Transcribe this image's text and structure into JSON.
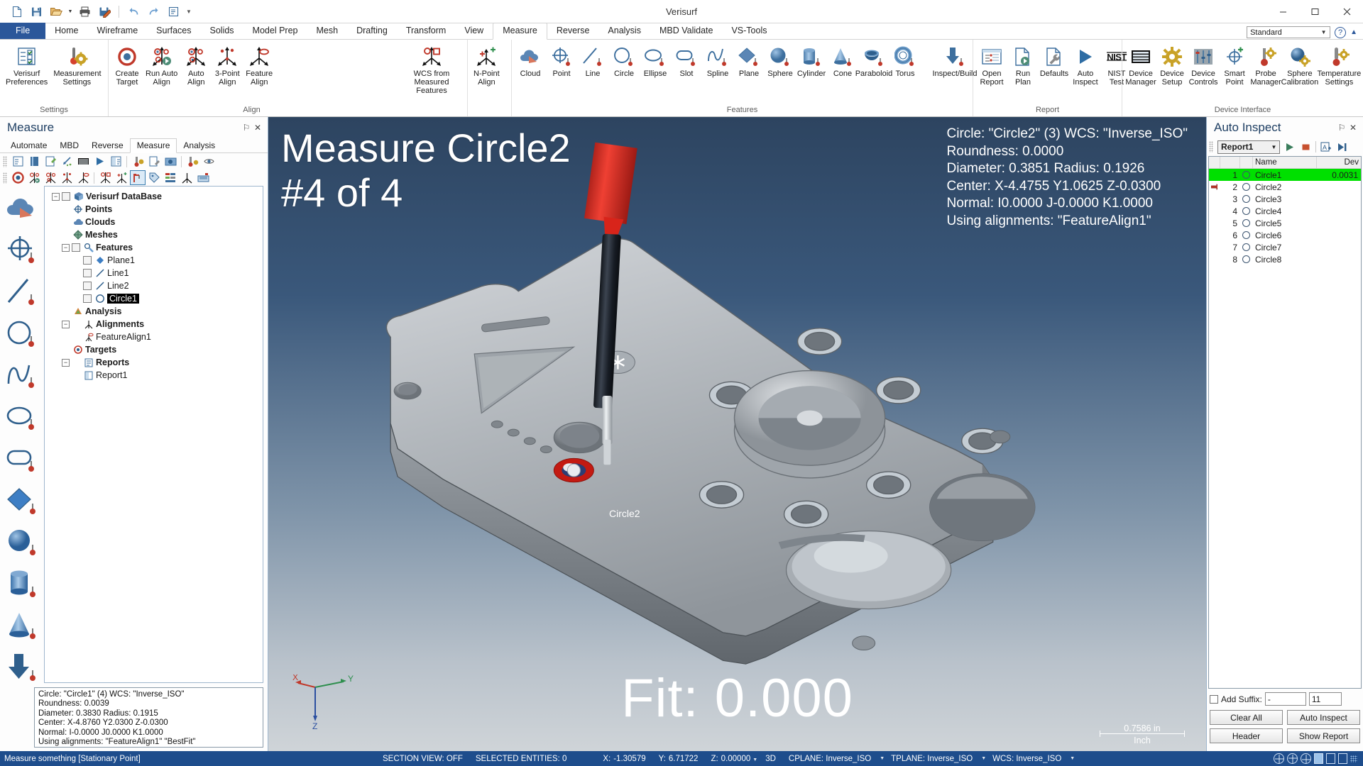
{
  "window": {
    "title": "Verisurf",
    "minimize": "–",
    "maximize": "☐",
    "close": "✕"
  },
  "quick_access": [
    {
      "name": "new-icon",
      "label": "New"
    },
    {
      "name": "save-icon",
      "label": "Save"
    },
    {
      "name": "open-icon",
      "label": "Open"
    },
    {
      "name": "open-dropdown-icon",
      "label": "▾"
    },
    {
      "name": "print-icon",
      "label": "Print"
    },
    {
      "name": "save-as-icon",
      "label": "Save As"
    },
    {
      "name": "undo-icon",
      "label": "Undo"
    },
    {
      "name": "redo-icon",
      "label": "Redo"
    },
    {
      "name": "properties-icon",
      "label": "Properties"
    },
    {
      "name": "customize-qat-icon",
      "label": "▾"
    }
  ],
  "ribbon": {
    "tabs": [
      {
        "label": "File",
        "kind": "file"
      },
      {
        "label": "Home"
      },
      {
        "label": "Wireframe"
      },
      {
        "label": "Surfaces"
      },
      {
        "label": "Solids"
      },
      {
        "label": "Model Prep"
      },
      {
        "label": "Mesh"
      },
      {
        "label": "Drafting"
      },
      {
        "label": "Transform"
      },
      {
        "label": "View"
      },
      {
        "label": "Measure",
        "active": true
      },
      {
        "label": "Reverse"
      },
      {
        "label": "Analysis"
      },
      {
        "label": "MBD Validate"
      },
      {
        "label": "VS-Tools"
      }
    ],
    "config_combo": "Standard",
    "help_label": "?",
    "groups": [
      {
        "name": "settings",
        "label": "Settings",
        "buttons": [
          {
            "label": "Verisurf\nPreferences",
            "icon": "preferences-icon"
          },
          {
            "label": "Measurement\nSettings",
            "icon": "measurement-settings-icon"
          }
        ]
      },
      {
        "name": "align",
        "label": "Align",
        "buttons": [
          {
            "label": "Create\nTarget",
            "icon": "create-target-icon"
          },
          {
            "label": "Run Auto\nAlign",
            "icon": "run-auto-align-icon"
          },
          {
            "label": "Auto\nAlign",
            "icon": "auto-align-icon"
          },
          {
            "label": "3-Point\nAlign",
            "icon": "three-point-align-icon"
          },
          {
            "label": "Feature\nAlign",
            "icon": "feature-align-icon"
          },
          {
            "label": "WCS from\nMeasured Features",
            "icon": "wcs-from-measured-features-icon"
          },
          {
            "label": "N-Point\nAlign",
            "icon": "n-point-align-icon"
          }
        ]
      },
      {
        "name": "features",
        "label": "Features",
        "buttons": [
          {
            "label": "Cloud",
            "icon": "cloud-icon"
          },
          {
            "label": "Point",
            "icon": "point-icon"
          },
          {
            "label": "Line",
            "icon": "line-icon"
          },
          {
            "label": "Circle",
            "icon": "circle-icon"
          },
          {
            "label": "Ellipse",
            "icon": "ellipse-icon"
          },
          {
            "label": "Slot",
            "icon": "slot-icon"
          },
          {
            "label": "Spline",
            "icon": "spline-icon"
          },
          {
            "label": "Plane",
            "icon": "plane-icon"
          },
          {
            "label": "Sphere",
            "icon": "sphere-icon"
          },
          {
            "label": "Cylinder",
            "icon": "cylinder-icon"
          },
          {
            "label": "Cone",
            "icon": "cone-icon"
          },
          {
            "label": "Paraboloid",
            "icon": "paraboloid-icon"
          },
          {
            "label": "Torus",
            "icon": "torus-icon"
          },
          {
            "label": "Inspect/Build",
            "icon": "inspect-build-icon"
          }
        ]
      },
      {
        "name": "report",
        "label": "Report",
        "buttons": [
          {
            "label": "Open\nReport",
            "icon": "open-report-icon"
          },
          {
            "label": "Run\nPlan",
            "icon": "run-plan-icon"
          },
          {
            "label": "Defaults",
            "icon": "defaults-icon"
          },
          {
            "label": "Auto\nInspect",
            "icon": "auto-inspect-icon"
          },
          {
            "label": "NIST\nTest",
            "icon": "nist-test-icon"
          }
        ]
      },
      {
        "name": "device-interface",
        "label": "Device Interface",
        "buttons": [
          {
            "label": "Device\nManager",
            "icon": "device-manager-icon"
          },
          {
            "label": "Device\nSetup",
            "icon": "device-setup-icon"
          },
          {
            "label": "Device\nControls",
            "icon": "device-controls-icon"
          },
          {
            "label": "Smart\nPoint",
            "icon": "smart-point-icon"
          },
          {
            "label": "Probe\nManager",
            "icon": "probe-manager-icon"
          },
          {
            "label": "Sphere\nCalibration",
            "icon": "sphere-calibration-icon"
          },
          {
            "label": "Temperature\nSettings",
            "icon": "temperature-settings-icon"
          }
        ]
      }
    ]
  },
  "left_panel": {
    "title": "Measure",
    "pin": "⚐",
    "close": "✕",
    "subtabs": [
      {
        "label": "Automate"
      },
      {
        "label": "MBD"
      },
      {
        "label": "Reverse"
      },
      {
        "label": "Measure",
        "active": true
      },
      {
        "label": "Analysis"
      }
    ],
    "toolbar_row1": [
      "list-icon",
      "book-icon",
      "new-sheet-icon",
      "nudge-icon",
      "grid-icon",
      "play-icon",
      "report-icon",
      "thermometer-icon",
      "plan-edit-icon",
      "screenshot-icon",
      "calibrate-icon",
      "eye-icon"
    ],
    "toolbar_row2": [
      "target-icon",
      "run-auto-align-icon",
      "auto-align-icon",
      "three-point-align-icon",
      "feature-align-icon",
      "wcs-features-icon",
      "n-point-align-icon",
      "probe-arm-icon",
      "tag-icon",
      "layers-icon",
      "axis-icon",
      "device-icon"
    ],
    "feature_bar": [
      "cloud-icon",
      "point-icon",
      "line-icon",
      "circle-icon",
      "spline-icon",
      "ellipse-icon",
      "slot-icon",
      "plane-icon",
      "sphere-icon",
      "cylinder-icon",
      "cone-icon",
      "inspect-build-icon"
    ],
    "tree": [
      {
        "label": "Verisurf DataBase",
        "depth": 0,
        "bold": true,
        "expander": "-",
        "checkbox": true,
        "icon": "database-icon"
      },
      {
        "label": "Points",
        "depth": 1,
        "bold": true,
        "icon": "point-icon"
      },
      {
        "label": "Clouds",
        "depth": 1,
        "bold": true,
        "icon": "cloud-icon"
      },
      {
        "label": "Meshes",
        "depth": 1,
        "bold": true,
        "icon": "mesh-icon"
      },
      {
        "label": "Features",
        "depth": 1,
        "bold": true,
        "expander": "-",
        "checkbox": true,
        "icon": "features-icon"
      },
      {
        "label": "Plane1",
        "depth": 2,
        "checkbox": true,
        "icon": "plane-icon"
      },
      {
        "label": "Line1",
        "depth": 2,
        "checkbox": true,
        "icon": "line-icon"
      },
      {
        "label": "Line2",
        "depth": 2,
        "checkbox": true,
        "icon": "line-icon"
      },
      {
        "label": "Circle1",
        "depth": 2,
        "checkbox": true,
        "icon": "circle-icon",
        "selected": true
      },
      {
        "label": "Analysis",
        "depth": 1,
        "bold": true,
        "icon": "analysis-icon"
      },
      {
        "label": "Alignments",
        "depth": 1,
        "bold": true,
        "expander": "-",
        "icon": "alignments-icon"
      },
      {
        "label": "FeatureAlign1",
        "depth": 2,
        "icon": "align-icon"
      },
      {
        "label": "Targets",
        "depth": 1,
        "bold": true,
        "icon": "target-icon"
      },
      {
        "label": "Reports",
        "depth": 1,
        "bold": true,
        "expander": "-",
        "icon": "reports-icon"
      },
      {
        "label": "Report1",
        "depth": 2,
        "icon": "report-item-icon"
      }
    ],
    "info_lines": [
      "Circle: \"Circle1\" (4)  WCS: \"Inverse_ISO\"",
      "Roundness: 0.0039",
      "Diameter: 0.3830  Radius: 0.1915",
      "Center: X-4.8760 Y2.0300 Z-0.0300",
      "Normal: I-0.0000 J0.0000 K1.0000",
      "Using alignments: \"FeatureAlign1\" \"BestFit\""
    ]
  },
  "viewport": {
    "overlay_title_line1": "Measure Circle2",
    "overlay_title_line2": "#4 of 4",
    "hud_lines": [
      "Circle: \"Circle2\" (3)  WCS: \"Inverse_ISO\"",
      "Roundness: 0.0000",
      "Diameter: 0.3851  Radius: 0.1926",
      "Center: X-4.4755 Y1.0625 Z-0.0300",
      "Normal: I0.0000 J-0.0000 K1.0000",
      "Using alignments: \"FeatureAlign1\""
    ],
    "fit_label": "Fit: 0.000",
    "feature_label": "Circle2",
    "scale_line1": "0.7586 in",
    "scale_line2": "Inch",
    "axis": {
      "x": "X",
      "y": "Y",
      "z": "Z"
    }
  },
  "right_panel": {
    "title": "Auto Inspect",
    "pin": "⚐",
    "close": "✕",
    "report_combo": "Report1",
    "toolbar_icons": [
      "play-icon",
      "stop-icon",
      "add-feature-icon",
      "skip-icon"
    ],
    "columns": [
      "",
      "",
      "",
      "Name",
      "Dev"
    ],
    "rows": [
      {
        "arrow": false,
        "num": "1",
        "name": "Circle1",
        "dev": "0.0031",
        "selected": true
      },
      {
        "arrow": true,
        "num": "2",
        "name": "Circle2",
        "dev": ""
      },
      {
        "arrow": false,
        "num": "3",
        "name": "Circle3",
        "dev": ""
      },
      {
        "arrow": false,
        "num": "4",
        "name": "Circle4",
        "dev": ""
      },
      {
        "arrow": false,
        "num": "5",
        "name": "Circle5",
        "dev": ""
      },
      {
        "arrow": false,
        "num": "6",
        "name": "Circle6",
        "dev": ""
      },
      {
        "arrow": false,
        "num": "7",
        "name": "Circle7",
        "dev": ""
      },
      {
        "arrow": false,
        "num": "8",
        "name": "Circle8",
        "dev": ""
      }
    ],
    "add_suffix_label": "Add Suffix:",
    "suffix_value": "-",
    "suffix_number": "11",
    "buttons": {
      "clear_all": "Clear All",
      "auto_inspect": "Auto Inspect",
      "header": "Header",
      "show_report": "Show Report"
    }
  },
  "statusbar": {
    "message": "Measure something [Stationary Point]",
    "section_view": "SECTION VIEW: OFF",
    "selected_entities": "SELECTED ENTITIES: 0",
    "x_label": "X:",
    "x_value": "-1.30579",
    "y_label": "Y:",
    "y_value": "6.71722",
    "z_label": "Z:",
    "z_value": "0.00000",
    "mode": "3D",
    "cplane": "CPLANE: Inverse_ISO",
    "tplane": "TPLANE: Inverse_ISO",
    "wcs": "WCS: Inverse_ISO"
  },
  "colors": {
    "accent": "#2b579a",
    "status_bar": "#1e4d8c",
    "selection_green": "#00e000",
    "ribbon_bg": "#ffffff"
  }
}
